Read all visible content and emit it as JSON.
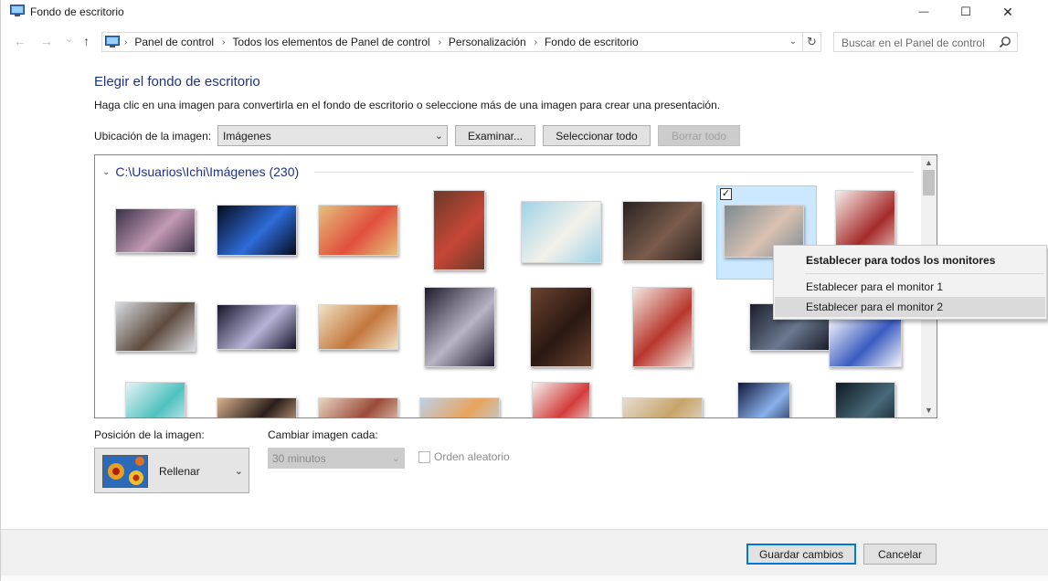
{
  "window": {
    "title": "Fondo de escritorio",
    "minimize_glyph": "—",
    "maximize_glyph": "☐",
    "close_glyph": "✕"
  },
  "navigation": {
    "back_glyph": "←",
    "forward_glyph": "→",
    "recent_glyph": "⌄",
    "up_glyph": "↑",
    "breadcrumbs": [
      "Panel de control",
      "Todos los elementos de Panel de control",
      "Personalización",
      "Fondo de escritorio"
    ],
    "separator": "›",
    "dropdown_glyph": "⌄",
    "refresh_glyph": "↻",
    "search_placeholder": "Buscar en el Panel de control"
  },
  "main": {
    "heading": "Elegir el fondo de escritorio",
    "description": "Haga clic en una imagen para convertirla en el fondo de escritorio o seleccione más de una imagen para crear una presentación.",
    "location_label": "Ubicación de la imagen:",
    "location_value": "Imágenes",
    "browse_button": "Examinar...",
    "select_all_button": "Seleccionar todo",
    "clear_all_button": "Borrar todo"
  },
  "gallery": {
    "group_title": "C:\\Usuarios\\Ichi\\Imágenes (230)",
    "selected_check": "✓",
    "scroll_up": "▲",
    "scroll_down": "▼",
    "thumbnails": [
      {
        "c1": "#3a3148",
        "c2": "#c49ab4"
      },
      {
        "c1": "#050c1c",
        "c2": "#2e6cd8"
      },
      {
        "c1": "#e5c07d",
        "c2": "#e0503c"
      },
      {
        "c1": "#6b3a2a",
        "c2": "#c74636"
      },
      {
        "c1": "#9fd3e8",
        "c2": "#f4f1ea"
      },
      {
        "c1": "#2a2220",
        "c2": "#7a5c4c"
      },
      {
        "c1": "#7d8a92",
        "c2": "#d9c2b2"
      },
      {
        "c1": "#f6eeea",
        "c2": "#a52a2a"
      },
      {
        "c1": "#d8dde2",
        "c2": "#5e4a3e"
      },
      {
        "c1": "#15142a",
        "c2": "#b6b3d6"
      },
      {
        "c1": "#f0e2c6",
        "c2": "#c3773c"
      },
      {
        "c1": "#201a2e",
        "c2": "#b9b4c4"
      },
      {
        "c1": "#6b4330",
        "c2": "#2a1812"
      },
      {
        "c1": "#f2e8e2",
        "c2": "#b8362c"
      },
      {
        "c1": "#1a1d28",
        "c2": "#6a7890"
      },
      {
        "c1": "#f4f4fa",
        "c2": "#3a5cc0"
      },
      {
        "c1": "#e6f2f4",
        "c2": "#4fc2c0"
      },
      {
        "c1": "#d8b08c",
        "c2": "#2a1e1a"
      },
      {
        "c1": "#e8d6c2",
        "c2": "#9a4a3a"
      },
      {
        "c1": "#bcd2e6",
        "c2": "#e8a45c"
      },
      {
        "c1": "#f4f2ee",
        "c2": "#d23c3c"
      },
      {
        "c1": "#e6dcd0",
        "c2": "#c7a46a"
      },
      {
        "c1": "#10183a",
        "c2": "#8ab0ea"
      },
      {
        "c1": "#0e1a22",
        "c2": "#486878"
      }
    ]
  },
  "context_menu": {
    "items": [
      {
        "label": "Establecer para todos los monitores",
        "bold": true
      },
      {
        "label": "Establecer para el monitor 1",
        "bold": false
      },
      {
        "label": "Establecer para el monitor 2",
        "bold": false
      }
    ]
  },
  "options": {
    "position_label": "Posición de la imagen:",
    "position_value": "Rellenar",
    "interval_label": "Cambiar imagen cada:",
    "interval_value": "30 minutos",
    "shuffle_label": "Orden aleatorio",
    "chevron": "⌄"
  },
  "footer": {
    "save_button": "Guardar cambios",
    "cancel_button": "Cancelar"
  },
  "colors": {
    "heading": "#1e3287",
    "accent": "#0078d7",
    "selection": "#cce8ff"
  }
}
